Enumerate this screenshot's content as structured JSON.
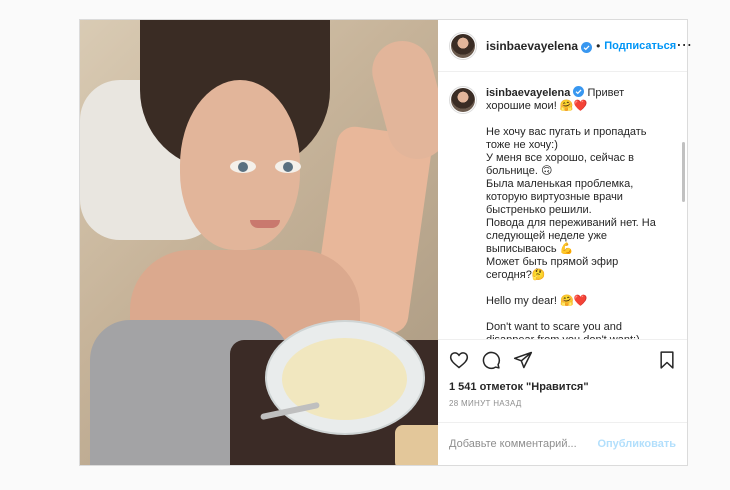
{
  "post": {
    "username": "isinbaevayelena",
    "follow_label": "Подписаться",
    "dot": "•",
    "more_icon": "⋯",
    "caption": {
      "username": "isinbaevayelena",
      "text": " Привет хорошие мои! 🤗❤️\n\nНе хочу вас пугать и пропадать тоже не хочу:)\nУ меня все хорошо, сейчас в больнице. 🙃\nБыла маленькая проблемка, которую виртуозные врачи быстренько решили.\nПовода для переживаний нет. На следующей неделе уже выписываюсь 💪\nМожет быть прямой эфир сегодня?🤔\n\nHello my dear! 🤗❤️\n\nDon't want to scare you and disappear from you don't want:)"
    },
    "likes_text": "1 541 отметок \"Нравится\"",
    "timestamp": "28 МИНУТ НАЗАД",
    "comment_placeholder": "Добавьте комментарий...",
    "publish_label": "Опубликовать"
  },
  "icons": {
    "verified": "verified-badge-icon",
    "like": "heart-icon",
    "comment": "comment-icon",
    "share": "share-icon",
    "save": "bookmark-icon"
  },
  "colors": {
    "accent": "#0095f6",
    "publish_disabled": "#b2dffc",
    "border": "#dbdbdb",
    "muted": "#8e8e8e"
  }
}
